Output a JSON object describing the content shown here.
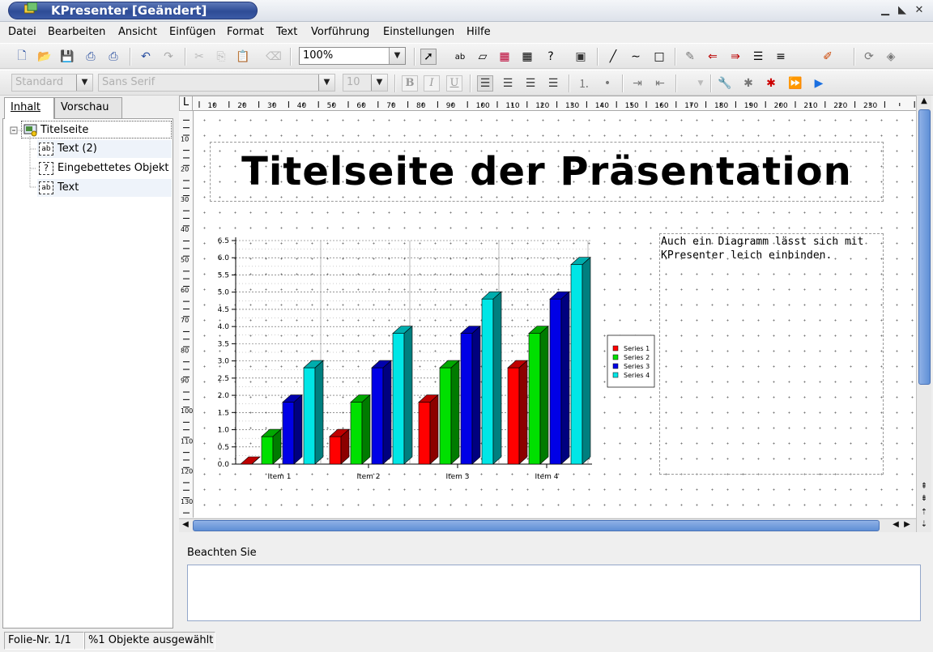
{
  "window": {
    "title": "KPresenter [Geändert]"
  },
  "menu": [
    "Datei",
    "Bearbeiten",
    "Ansicht",
    "Einfügen",
    "Format",
    "Text",
    "Vorführung",
    "Einstellungen",
    "Hilfe"
  ],
  "toolbar": {
    "zoom": "100%",
    "style": "Standard",
    "font": "Sans Serif",
    "font_size": "10",
    "bold": "B",
    "italic": "I",
    "underline": "U"
  },
  "sidebar": {
    "tabs": [
      "Inhalt",
      "Vorschau"
    ],
    "tree": [
      {
        "label": "Titelseite",
        "icon": "slide-icon"
      },
      {
        "label": "Text (2)",
        "icon": "text-object-icon",
        "icon_text": "ab"
      },
      {
        "label": "Eingebettetes Objekt",
        "icon": "embedded-object-icon",
        "icon_text": "?"
      },
      {
        "label": "Text",
        "icon": "text-object-icon",
        "icon_text": "ab"
      }
    ]
  },
  "ruler": {
    "h_labels": [
      "10",
      "20",
      "30",
      "40",
      "50",
      "60",
      "70",
      "80",
      "90",
      "100",
      "110",
      "120",
      "130",
      "140",
      "150",
      "160",
      "170",
      "180",
      "190",
      "200",
      "210",
      "220",
      "230"
    ],
    "v_labels": [
      "10",
      "20",
      "30",
      "40",
      "50",
      "60",
      "70",
      "80",
      "90",
      "100",
      "110",
      "120",
      "130"
    ]
  },
  "slide": {
    "title": "Titelseite der Präsentation",
    "body_text": "Auch ein Diagramm lässt sich mit KPresenter leich einbinden."
  },
  "chart_data": {
    "type": "bar",
    "categories": [
      "Item 1",
      "Item 2",
      "Item 3",
      "Item 4"
    ],
    "series": [
      {
        "name": "Series 1",
        "color": "#ff0000",
        "values": [
          0.0,
          0.8,
          1.8,
          2.8
        ]
      },
      {
        "name": "Series 2",
        "color": "#00e000",
        "values": [
          0.8,
          1.8,
          2.8,
          3.8
        ]
      },
      {
        "name": "Series 3",
        "color": "#0000e6",
        "values": [
          1.8,
          2.8,
          3.8,
          4.8
        ]
      },
      {
        "name": "Series 4",
        "color": "#00e6e6",
        "values": [
          2.8,
          3.8,
          4.8,
          5.8
        ]
      }
    ],
    "ylim": [
      0,
      6.5
    ],
    "yticks": [
      "0.0",
      "0.5",
      "1.0",
      "1.5",
      "2.0",
      "2.5",
      "3.0",
      "3.5",
      "4.0",
      "4.5",
      "5.0",
      "5.5",
      "6.0",
      "6.5"
    ],
    "legend": "right",
    "grid": true
  },
  "notes": {
    "label": "Beachten Sie",
    "text": ""
  },
  "status": {
    "slide": "Folie-Nr. 1/1",
    "selection": "%1 Objekte ausgewählt"
  }
}
